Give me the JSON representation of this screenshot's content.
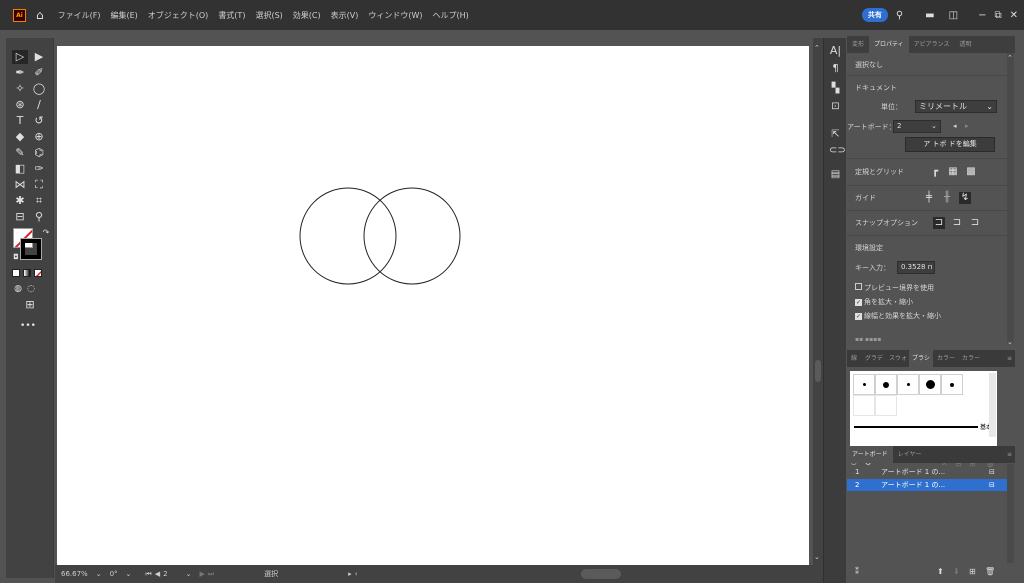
{
  "menubar": {
    "logo": "Ai",
    "menus": [
      "ファイル(F)",
      "編集(E)",
      "オブジェクト(O)",
      "書式(T)",
      "選択(S)",
      "効果(C)",
      "表示(V)",
      "ウィンドウ(W)",
      "ヘルプ(H)"
    ],
    "share_label": "共有"
  },
  "statusbar": {
    "zoom": "66.67%",
    "rotation": "0°",
    "artboard_num": "2",
    "tool_status": "選択"
  },
  "rpanel": {
    "tabs": [
      "変形",
      "プロパティ",
      "アピアランス",
      "透明"
    ],
    "selection_status": "選択なし",
    "document_heading": "ドキュメント",
    "unit_label": "単位：",
    "unit_value": "ミリメートル",
    "artboard_label": "アートボード：",
    "artboard_value": "2",
    "edit_artboard_button": "ア トボ ドを編集",
    "ruler_grid_label": "定規とグリッド",
    "guide_label": "ガイド",
    "snap_label": "スナップオプション",
    "prefs_heading": "環境設定",
    "key_input_label": "キー入力：",
    "key_input_value": "0.3528 п",
    "preview_bounds_label": "プレビュー境界を使用",
    "scale_corners_label": "角を拡大・縮小",
    "scale_strokes_label": "線幅と効果を拡大・縮小",
    "brush_tabs": [
      "線",
      "グラデ",
      "スウォ",
      "ブラシ",
      "カラー",
      "カラー"
    ],
    "brush_name": "基本",
    "layer_tabs": [
      "アートボード",
      "レイヤー"
    ],
    "artboards": [
      {
        "num": "1",
        "name": "アートボード 1 の..."
      },
      {
        "num": "2",
        "name": "アートボード 1 の..."
      }
    ]
  },
  "colors": {
    "accent": "#2f6fd0",
    "menubar_bg": "#323232",
    "panel_bg": "#535353"
  }
}
